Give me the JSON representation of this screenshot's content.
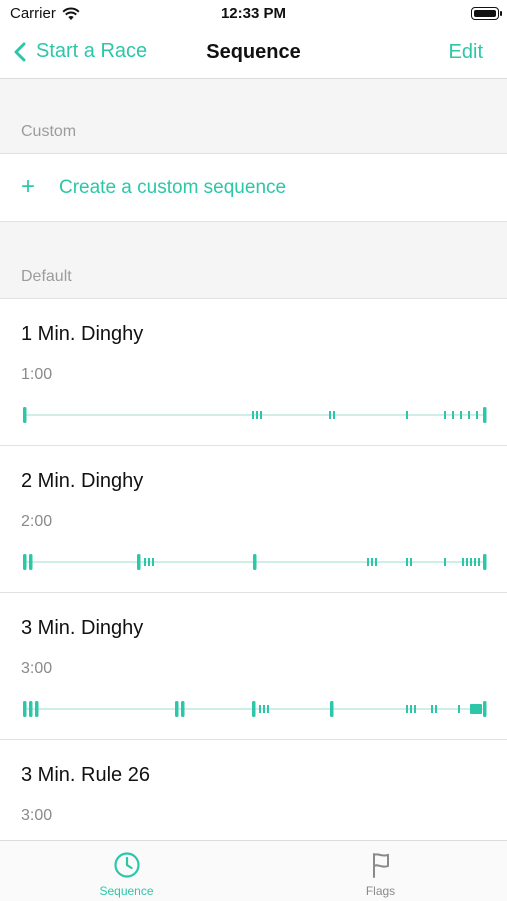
{
  "status": {
    "carrier": "Carrier",
    "time": "12:33 PM"
  },
  "nav": {
    "back_label": "Start a Race",
    "title": "Sequence",
    "edit_label": "Edit"
  },
  "sections": {
    "custom": {
      "header": "Custom",
      "create_label": "Create a custom sequence",
      "create_icon": "+"
    },
    "default": {
      "header": "Default"
    }
  },
  "sequences": [
    {
      "name": "1 Min. Dinghy",
      "duration": "1:00"
    },
    {
      "name": "2 Min. Dinghy",
      "duration": "2:00"
    },
    {
      "name": "3 Min. Dinghy",
      "duration": "3:00"
    },
    {
      "name": "3 Min. Rule 26",
      "duration": "3:00"
    }
  ],
  "tabs": [
    {
      "label": "Sequence",
      "icon": "clock-icon",
      "active": true
    },
    {
      "label": "Flags",
      "icon": "flag-icon",
      "active": false
    }
  ],
  "colors": {
    "accent": "#2cc7a8",
    "timeline": "#2cc7a8",
    "line": "#bfe9df",
    "inactive": "#8a8a8a"
  }
}
